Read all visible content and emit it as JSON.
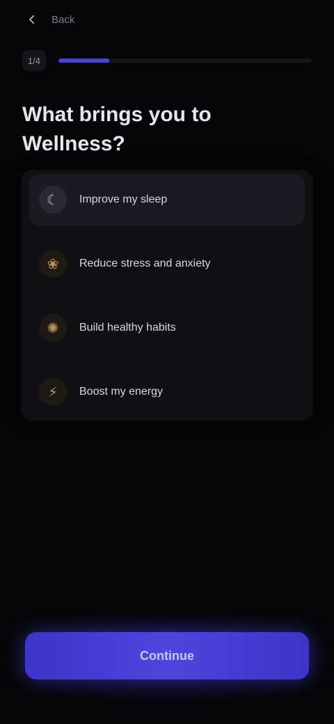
{
  "header": {
    "back_icon": "arrow-left-icon",
    "label": "Back"
  },
  "progress": {
    "step_label": "1/4",
    "fraction": 0.2,
    "accent": "#4b45d6"
  },
  "question": {
    "title": "What brings you to Wellness?"
  },
  "options": [
    {
      "label": "Improve my sleep",
      "icon": "moon-icon",
      "glyph": "☾",
      "color": "#c9c9d6",
      "selected": true
    },
    {
      "label": "Reduce stress and anxiety",
      "icon": "leaf-icon",
      "glyph": "❀",
      "color": "#b8905a",
      "selected": false
    },
    {
      "label": "Build healthy habits",
      "icon": "sun-icon",
      "glyph": "✺",
      "color": "#b8905a",
      "selected": false
    },
    {
      "label": "Boost my energy",
      "icon": "bolt-icon",
      "glyph": "⚡",
      "color": "#b8905a",
      "selected": false
    }
  ],
  "footer": {
    "continue_label": "Continue",
    "accent": "#4d45dd"
  }
}
